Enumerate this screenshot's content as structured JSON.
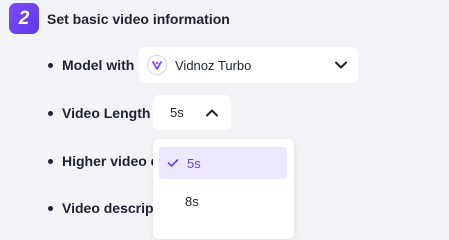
{
  "step": {
    "number": "2",
    "title": "Set basic video information"
  },
  "fields": {
    "model_label": "Model with",
    "model_value": "Vidnoz Turbo",
    "length_label": "Video Length",
    "length_value": "5s",
    "quality_label": "Higher video q",
    "description_label": "Video descript"
  },
  "length_dropdown": {
    "options": [
      "5s",
      "8s"
    ],
    "selected": "5s"
  },
  "colors": {
    "accent": "#6b45d8",
    "badge": "#7e4bff",
    "selected_bg": "#ece7fb",
    "page_bg": "#f3f4f7"
  },
  "icons": {
    "model_logo": "vidnoz-logo-icon",
    "model_chevron": "chevron-down-icon",
    "length_chevron": "chevron-up-icon",
    "selected_check": "check-icon"
  }
}
